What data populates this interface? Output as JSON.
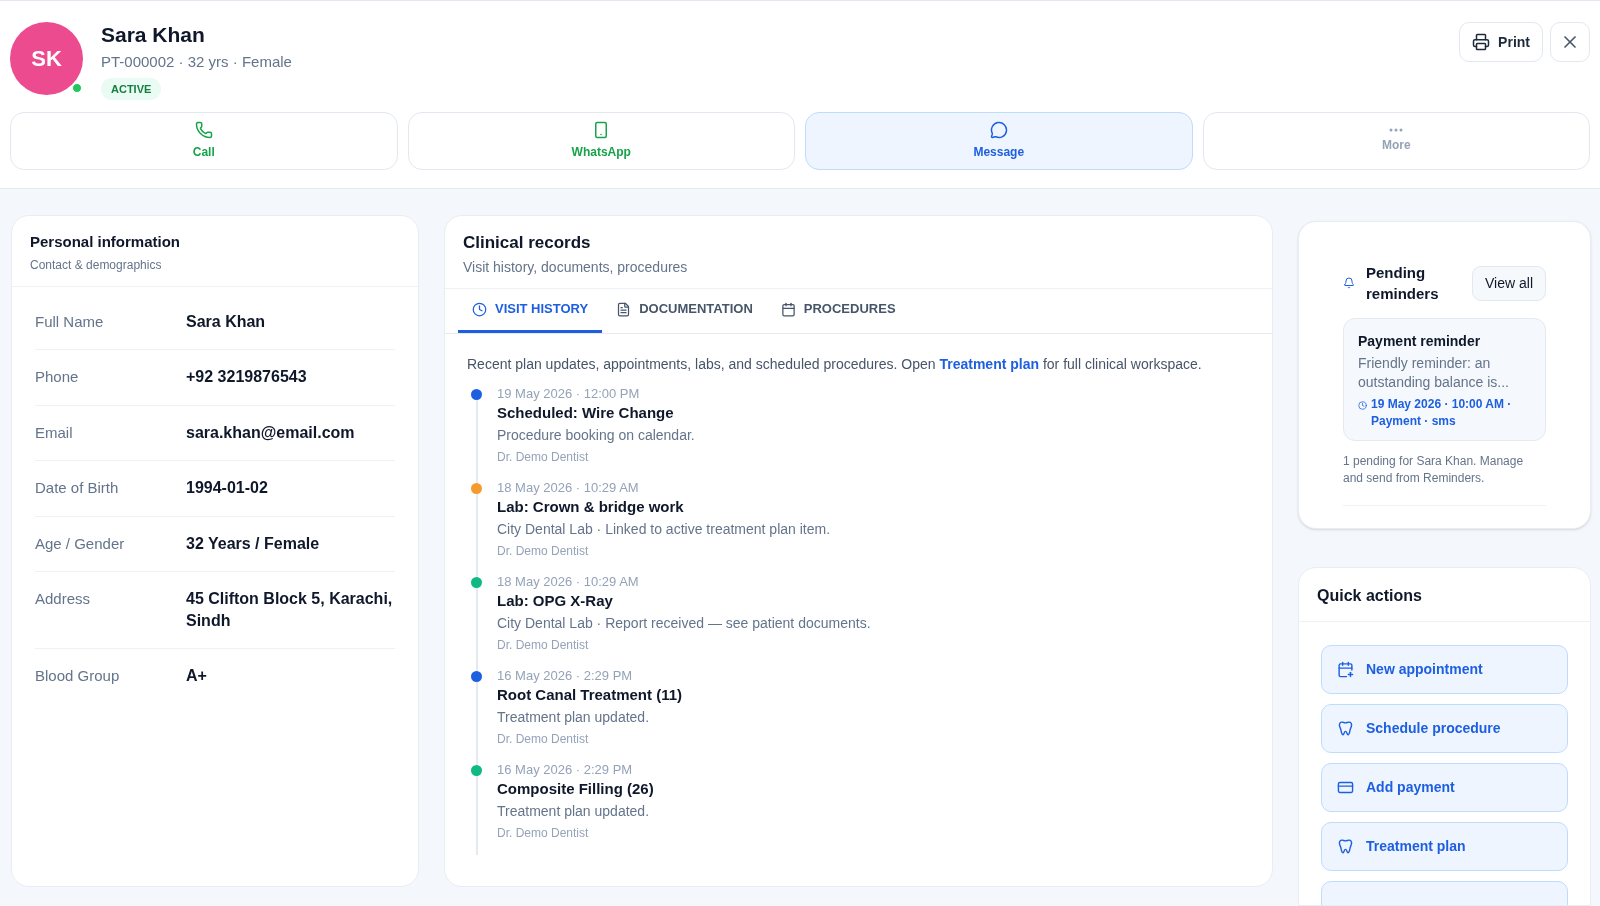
{
  "patient": {
    "initials": "SK",
    "name": "Sara Khan",
    "meta": "PT-000002 · 32 yrs · Female",
    "status": "ACTIVE",
    "online": true
  },
  "header_buttons": [
    {
      "kind": "print",
      "label": "Print"
    },
    {
      "kind": "close"
    }
  ],
  "contact_actions": [
    {
      "kind": "call",
      "label": "Call",
      "selected": false
    },
    {
      "kind": "whatsapp",
      "label": "WhatsApp",
      "selected": false
    },
    {
      "kind": "message",
      "label": "Message",
      "selected": true
    },
    {
      "kind": "more",
      "label": "More",
      "selected": false
    }
  ],
  "personal_info": {
    "title": "Personal information",
    "subtitle": "Contact & demographics",
    "fields": [
      {
        "label": "Full Name",
        "value": "Sara Khan"
      },
      {
        "label": "Phone",
        "value": "+92 3219876543"
      },
      {
        "label": "Email",
        "value": "sara.khan@email.com"
      },
      {
        "label": "Date of Birth",
        "value": "1994-01-02"
      },
      {
        "label": "Age / Gender",
        "value": "32 Years / Female"
      },
      {
        "label": "Address",
        "value": "45 Clifton Block 5, Karachi, Sindh"
      },
      {
        "label": "Blood Group",
        "value": "A+"
      }
    ]
  },
  "clinical_records": {
    "title": "Clinical records",
    "subtitle": "Visit history, documents, procedures",
    "tabs": [
      {
        "kind": "clock",
        "label": "VISIT HISTORY",
        "selected": true
      },
      {
        "kind": "document",
        "label": "DOCUMENTATION",
        "selected": false
      },
      {
        "kind": "calendar",
        "label": "PROCEDURES",
        "selected": false
      }
    ],
    "intro": {
      "before": "Recent plan updates, appointments, labs, and scheduled procedures. Open",
      "link": "Treatment plan",
      "after": "for full clinical workspace."
    },
    "timeline": [
      {
        "date": "19 May 2026 · 12:00 PM",
        "title": "Scheduled: Wire Change",
        "detail": "Procedure booking on calendar.",
        "author": "Dr. Demo Dentist",
        "color": "#1d5fe0"
      },
      {
        "date": "18 May 2026 · 10:29 AM",
        "title": "Lab: Crown & bridge work",
        "detail": "City Dental Lab · Linked to active treatment plan item.",
        "author": "Dr. Demo Dentist",
        "color": "#f59b2e"
      },
      {
        "date": "18 May 2026 · 10:29 AM",
        "title": "Lab: OPG X-Ray",
        "detail": "City Dental Lab · Report received — see patient documents.",
        "author": "Dr. Demo Dentist",
        "color": "#10b981"
      },
      {
        "date": "16 May 2026 · 2:29 PM",
        "title": "Root Canal Treatment (11)",
        "detail": "Treatment plan updated.",
        "author": "Dr. Demo Dentist",
        "color": "#1d5fe0"
      },
      {
        "date": "16 May 2026 · 2:29 PM",
        "title": "Composite Filling (26)",
        "detail": "Treatment plan updated.",
        "author": "Dr. Demo Dentist",
        "color": "#10b981"
      }
    ]
  },
  "reminders": {
    "title": "Pending reminders",
    "button": "View all",
    "items": [
      {
        "title": "Payment reminder",
        "body": "Friendly reminder: an outstanding balance is...",
        "meta": "19 May 2026 · 10:00 AM · Payment · sms"
      }
    ],
    "footer": "1 pending for Sara Khan. Manage and send from Reminders."
  },
  "quick_actions": {
    "title": "Quick actions",
    "items": [
      {
        "kind": "calendar",
        "label": "New appointment"
      },
      {
        "kind": "tooth",
        "label": "Schedule procedure"
      },
      {
        "kind": "card",
        "label": "Add payment"
      },
      {
        "kind": "tooth",
        "label": "Treatment plan"
      }
    ]
  }
}
